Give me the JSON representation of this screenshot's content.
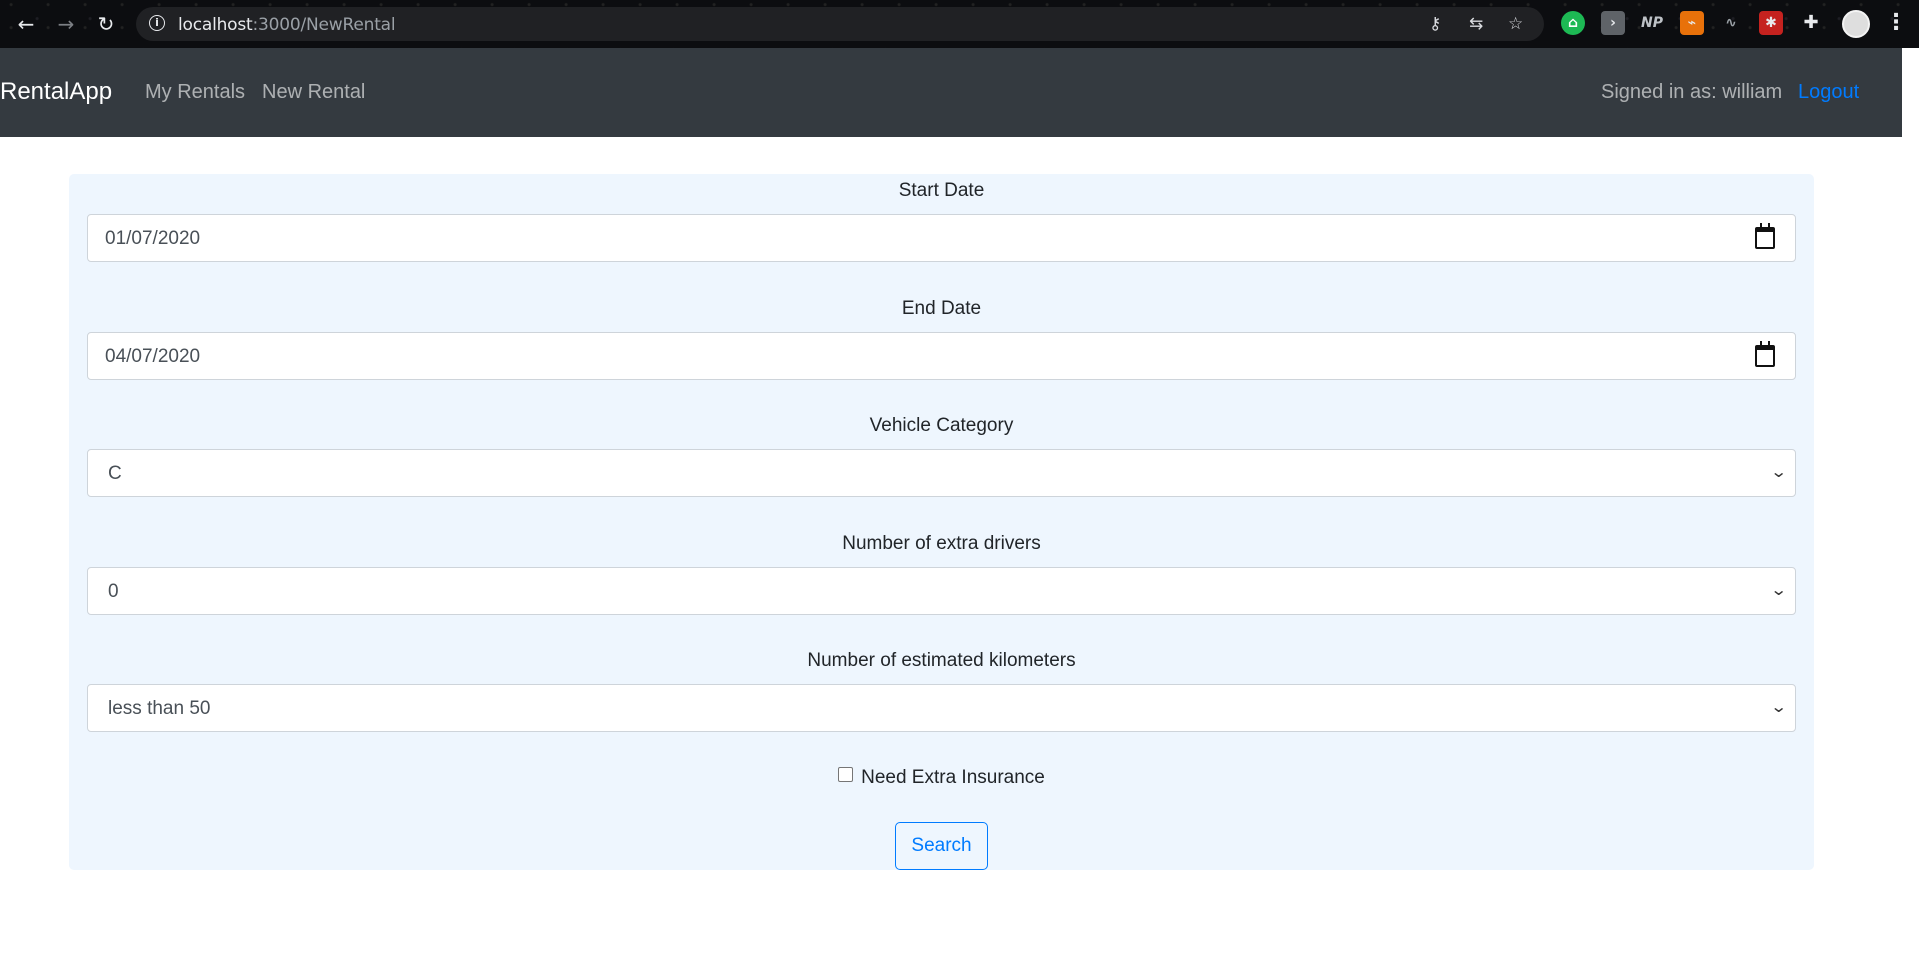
{
  "browser": {
    "url_host": "localhost",
    "url_path": ":3000/NewRental",
    "extensions": [
      "NP"
    ]
  },
  "navbar": {
    "brand": "RentalApp",
    "links": [
      "My Rentals",
      "New Rental"
    ],
    "signed_in_text": "Signed in as: william",
    "logout_label": "Logout"
  },
  "form": {
    "start_date": {
      "label": "Start Date",
      "value": "01/07/2020"
    },
    "end_date": {
      "label": "End Date",
      "value": "04/07/2020"
    },
    "vehicle_category": {
      "label": "Vehicle Category",
      "value": "C"
    },
    "extra_drivers": {
      "label": "Number of extra drivers",
      "value": "0"
    },
    "kilometers": {
      "label": "Number of estimated kilometers",
      "value": "less than 50"
    },
    "insurance": {
      "label": "Need Extra Insurance",
      "checked": false
    },
    "search_label": "Search"
  },
  "colors": {
    "navbar_bg": "#343a40",
    "form_bg": "#eef6fe",
    "accent": "#007bff"
  }
}
